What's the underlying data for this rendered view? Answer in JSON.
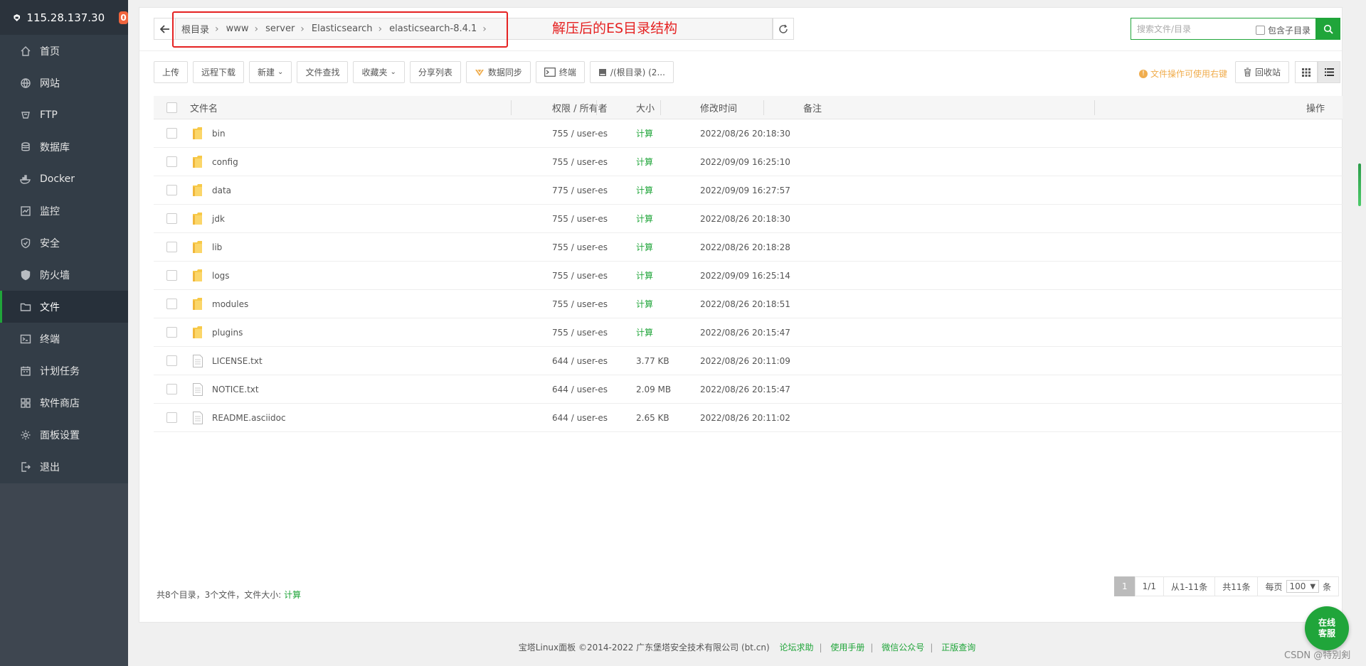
{
  "server": {
    "ip": "115.28.137.30",
    "badge": "0"
  },
  "sidebar": {
    "items": [
      {
        "label": "首页",
        "icon": "home-icon"
      },
      {
        "label": "网站",
        "icon": "globe-icon"
      },
      {
        "label": "FTP",
        "icon": "ftp-icon"
      },
      {
        "label": "数据库",
        "icon": "database-icon"
      },
      {
        "label": "Docker",
        "icon": "docker-icon"
      },
      {
        "label": "监控",
        "icon": "monitor-icon"
      },
      {
        "label": "安全",
        "icon": "shield-icon"
      },
      {
        "label": "防火墙",
        "icon": "firewall-icon"
      },
      {
        "label": "文件",
        "icon": "folder-icon",
        "active": true
      },
      {
        "label": "终端",
        "icon": "terminal-icon"
      },
      {
        "label": "计划任务",
        "icon": "calendar-icon"
      },
      {
        "label": "软件商店",
        "icon": "apps-icon"
      },
      {
        "label": "面板设置",
        "icon": "gear-icon"
      },
      {
        "label": "退出",
        "icon": "logout-icon"
      }
    ]
  },
  "path": {
    "crumbs": [
      "根目录",
      "www",
      "server",
      "Elasticsearch",
      "elasticsearch-8.4.1"
    ]
  },
  "annotation": {
    "text": "解压后的ES目录结构"
  },
  "search": {
    "placeholder": "搜索文件/目录",
    "include_sub": "包含子目录"
  },
  "toolbar": {
    "upload": "上传",
    "remote_download": "远程下载",
    "new": "新建",
    "file_search": "文件查找",
    "favorites": "收藏夹",
    "share_list": "分享列表",
    "data_sync": "数据同步",
    "terminal": "终端",
    "disk": "/(根目录) (2...",
    "tip": "文件操作可使用右键",
    "recycle": "回收站"
  },
  "table": {
    "headers": {
      "name": "文件名",
      "perm": "权限 / 所有者",
      "size": "大小",
      "time": "修改时间",
      "note": "备注",
      "ops": "操作"
    },
    "rows": [
      {
        "name": "bin",
        "type": "folder",
        "perm": "755 / user-es",
        "size": "计算",
        "time": "2022/08/26 20:18:30"
      },
      {
        "name": "config",
        "type": "folder",
        "perm": "755 / user-es",
        "size": "计算",
        "time": "2022/09/09 16:25:10"
      },
      {
        "name": "data",
        "type": "folder",
        "perm": "775 / user-es",
        "size": "计算",
        "time": "2022/09/09 16:27:57"
      },
      {
        "name": "jdk",
        "type": "folder",
        "perm": "755 / user-es",
        "size": "计算",
        "time": "2022/08/26 20:18:30"
      },
      {
        "name": "lib",
        "type": "folder",
        "perm": "755 / user-es",
        "size": "计算",
        "time": "2022/08/26 20:18:28"
      },
      {
        "name": "logs",
        "type": "folder",
        "perm": "755 / user-es",
        "size": "计算",
        "time": "2022/09/09 16:25:14"
      },
      {
        "name": "modules",
        "type": "folder",
        "perm": "755 / user-es",
        "size": "计算",
        "time": "2022/08/26 20:18:51"
      },
      {
        "name": "plugins",
        "type": "folder",
        "perm": "755 / user-es",
        "size": "计算",
        "time": "2022/08/26 20:15:47"
      },
      {
        "name": "LICENSE.txt",
        "type": "file",
        "perm": "644 / user-es",
        "size": "3.77 KB",
        "time": "2022/08/26 20:11:09"
      },
      {
        "name": "NOTICE.txt",
        "type": "file",
        "perm": "644 / user-es",
        "size": "2.09 MB",
        "time": "2022/08/26 20:15:47"
      },
      {
        "name": "README.asciidoc",
        "type": "file",
        "perm": "644 / user-es",
        "size": "2.65 KB",
        "time": "2022/08/26 20:11:02"
      }
    ]
  },
  "summary": {
    "text": "共8个目录，3个文件，文件大小:",
    "calc": "计算"
  },
  "pager": {
    "current": "1",
    "pages": "1/1",
    "range": "从1-11条",
    "total": "共11条",
    "per_page_label": "每页",
    "per_page": "100",
    "unit": "条"
  },
  "footer": {
    "copyright": "宝塔Linux面板 ©2014-2022 广东堡塔安全技术有限公司 (bt.cn)",
    "links": [
      "论坛求助",
      "使用手册",
      "微信公众号",
      "正版查询"
    ]
  },
  "service": {
    "line1": "在线",
    "line2": "客服"
  },
  "watermark": "CSDN @特別剣",
  "colors": {
    "accent": "#20a53a",
    "sidebar": "#333d47",
    "annotation": "#e52222",
    "tip": "#f0ad4e"
  }
}
